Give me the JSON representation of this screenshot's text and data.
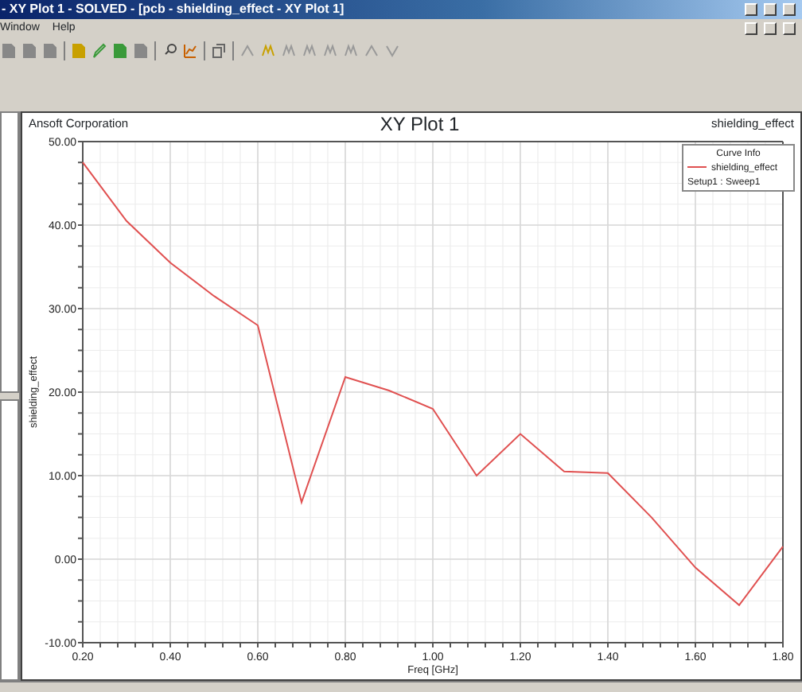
{
  "window": {
    "title": "- XY Plot 1 - SOLVED - [pcb - shielding_effect - XY Plot 1]"
  },
  "menu": [
    "Window",
    "Help"
  ],
  "plot": {
    "company": "Ansoft Corporation",
    "title": "XY Plot 1",
    "name": "shielding_effect",
    "legend": {
      "title": "Curve Info",
      "setup": "Setup1 : Sweep1"
    },
    "chart_data": {
      "type": "line",
      "xlabel": "Freq [GHz]",
      "ylabel": "shielding_effect",
      "x": [
        0.2,
        0.3,
        0.4,
        0.5,
        0.6,
        0.7,
        0.8,
        0.9,
        1.0,
        1.1,
        1.2,
        1.3,
        1.4,
        1.5,
        1.6,
        1.7,
        1.8
      ],
      "series": [
        {
          "name": "shielding_effect",
          "color": "#e05050",
          "values": [
            47.5,
            40.5,
            35.5,
            31.5,
            28,
            6.8,
            21.8,
            20.2,
            18,
            10,
            15,
            10.5,
            10.3,
            5,
            -1,
            -5.5,
            1.5
          ]
        }
      ],
      "grid": true,
      "xlim": [
        0.2,
        1.8
      ],
      "ylim": [
        -10,
        50
      ],
      "xticks": [
        {
          "value": 0.2,
          "label": "0.20"
        },
        {
          "value": 0.4,
          "label": "0.40"
        },
        {
          "value": 0.6,
          "label": "0.60"
        },
        {
          "value": 0.8,
          "label": "0.80"
        },
        {
          "value": 1.0,
          "label": "1.00"
        },
        {
          "value": 1.2,
          "label": "1.20"
        },
        {
          "value": 1.4,
          "label": "1.40"
        },
        {
          "value": 1.6,
          "label": "1.60"
        },
        {
          "value": 1.8,
          "label": "1.80"
        }
      ],
      "yticks": [
        {
          "value": -10,
          "label": "-10.00"
        },
        {
          "value": 0,
          "label": "0.00"
        },
        {
          "value": 10,
          "label": "10.00"
        },
        {
          "value": 20,
          "label": "20.00"
        },
        {
          "value": 30,
          "label": "30.00"
        },
        {
          "value": 40,
          "label": "40.00"
        },
        {
          "value": 50,
          "label": "50.00"
        }
      ]
    }
  }
}
